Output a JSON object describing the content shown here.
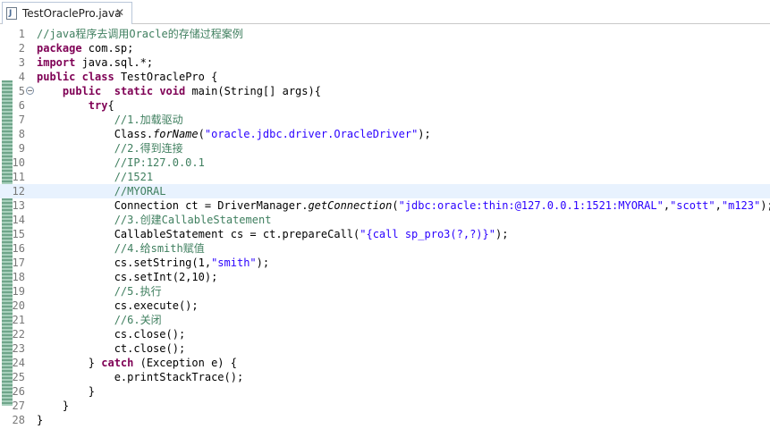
{
  "tab": {
    "title": "TestOraclePro.java",
    "close": "✕",
    "icon": "java-file-icon"
  },
  "gutter": {
    "fold_marker": "⊖"
  },
  "colors": {
    "keyword": "#7f0055",
    "comment": "#3f7f5f",
    "string": "#2a00ff",
    "current_line": "#e8f2fe"
  },
  "lines": [
    {
      "n": "1",
      "indent": "",
      "tokens": [
        {
          "t": "//java程序去调用Oracle的存储过程案例",
          "c": "cm"
        }
      ]
    },
    {
      "n": "2",
      "indent": "",
      "tokens": [
        {
          "t": "package",
          "c": "kw"
        },
        {
          "t": " com.sp;"
        }
      ]
    },
    {
      "n": "3",
      "indent": "",
      "tokens": [
        {
          "t": "import",
          "c": "kw"
        },
        {
          "t": " java.sql.*;"
        }
      ]
    },
    {
      "n": "4",
      "indent": "",
      "tokens": [
        {
          "t": "public",
          "c": "kw"
        },
        {
          "t": " "
        },
        {
          "t": "class",
          "c": "kw"
        },
        {
          "t": " TestOraclePro {"
        }
      ]
    },
    {
      "n": "5",
      "indent": "    ",
      "fold": true,
      "tokens": [
        {
          "t": "public",
          "c": "kw"
        },
        {
          "t": "  "
        },
        {
          "t": "static",
          "c": "kw"
        },
        {
          "t": " "
        },
        {
          "t": "void",
          "c": "kw"
        },
        {
          "t": " main(String[] args){"
        }
      ]
    },
    {
      "n": "6",
      "indent": "        ",
      "tokens": [
        {
          "t": "try",
          "c": "kw"
        },
        {
          "t": "{"
        }
      ]
    },
    {
      "n": "7",
      "indent": "            ",
      "tokens": [
        {
          "t": "//1.加载驱动",
          "c": "cm"
        }
      ]
    },
    {
      "n": "8",
      "indent": "            ",
      "tokens": [
        {
          "t": "Class."
        },
        {
          "t": "forName",
          "c": "it"
        },
        {
          "t": "("
        },
        {
          "t": "\"oracle.jdbc.driver.OracleDriver\"",
          "c": "str"
        },
        {
          "t": ");"
        }
      ]
    },
    {
      "n": "9",
      "indent": "            ",
      "tokens": [
        {
          "t": "//2.得到连接",
          "c": "cm"
        }
      ]
    },
    {
      "n": "10",
      "indent": "            ",
      "tokens": [
        {
          "t": "//IP:127.0.0.1",
          "c": "cm"
        }
      ]
    },
    {
      "n": "11",
      "indent": "            ",
      "tokens": [
        {
          "t": "//1521",
          "c": "cm"
        }
      ]
    },
    {
      "n": "12",
      "indent": "            ",
      "current": true,
      "tokens": [
        {
          "t": "//MYORAL",
          "c": "cm"
        }
      ]
    },
    {
      "n": "13",
      "indent": "            ",
      "tokens": [
        {
          "t": "Connection ct = DriverManager."
        },
        {
          "t": "getConnection",
          "c": "it"
        },
        {
          "t": "("
        },
        {
          "t": "\"jdbc:oracle:thin:@127.0.0.1:1521:MYORAL\"",
          "c": "str"
        },
        {
          "t": ","
        },
        {
          "t": "\"scott\"",
          "c": "str"
        },
        {
          "t": ","
        },
        {
          "t": "\"m123\"",
          "c": "str"
        },
        {
          "t": ");"
        }
      ]
    },
    {
      "n": "14",
      "indent": "            ",
      "tokens": [
        {
          "t": "//3.创建CallableStatement",
          "c": "cm"
        }
      ]
    },
    {
      "n": "15",
      "indent": "            ",
      "tokens": [
        {
          "t": "CallableStatement cs = ct.prepareCall("
        },
        {
          "t": "\"{call sp_pro3(?,?)}\"",
          "c": "str"
        },
        {
          "t": ");"
        }
      ]
    },
    {
      "n": "16",
      "indent": "            ",
      "tokens": [
        {
          "t": "//4.给smith赋值",
          "c": "cm"
        }
      ]
    },
    {
      "n": "17",
      "indent": "            ",
      "tokens": [
        {
          "t": "cs.setString(1,"
        },
        {
          "t": "\"smith\"",
          "c": "str"
        },
        {
          "t": ");"
        }
      ]
    },
    {
      "n": "18",
      "indent": "            ",
      "tokens": [
        {
          "t": "cs.setInt(2,10);"
        }
      ]
    },
    {
      "n": "19",
      "indent": "            ",
      "tokens": [
        {
          "t": "//5.执行",
          "c": "cm"
        }
      ]
    },
    {
      "n": "20",
      "indent": "            ",
      "tokens": [
        {
          "t": "cs.execute();"
        }
      ]
    },
    {
      "n": "21",
      "indent": "            ",
      "tokens": [
        {
          "t": "//6.关闭",
          "c": "cm"
        }
      ]
    },
    {
      "n": "22",
      "indent": "            ",
      "tokens": [
        {
          "t": "cs.close();"
        }
      ]
    },
    {
      "n": "23",
      "indent": "            ",
      "tokens": [
        {
          "t": "ct.close();"
        }
      ]
    },
    {
      "n": "24",
      "indent": "        ",
      "tokens": [
        {
          "t": "} "
        },
        {
          "t": "catch",
          "c": "kw"
        },
        {
          "t": " (Exception e) {"
        }
      ]
    },
    {
      "n": "25",
      "indent": "            ",
      "tokens": [
        {
          "t": "e.printStackTrace();"
        }
      ]
    },
    {
      "n": "26",
      "indent": "        ",
      "tokens": [
        {
          "t": "}"
        }
      ]
    },
    {
      "n": "27",
      "indent": "    ",
      "tokens": [
        {
          "t": "}"
        }
      ]
    },
    {
      "n": "28",
      "indent": "",
      "tokens": [
        {
          "t": "}"
        }
      ]
    }
  ]
}
